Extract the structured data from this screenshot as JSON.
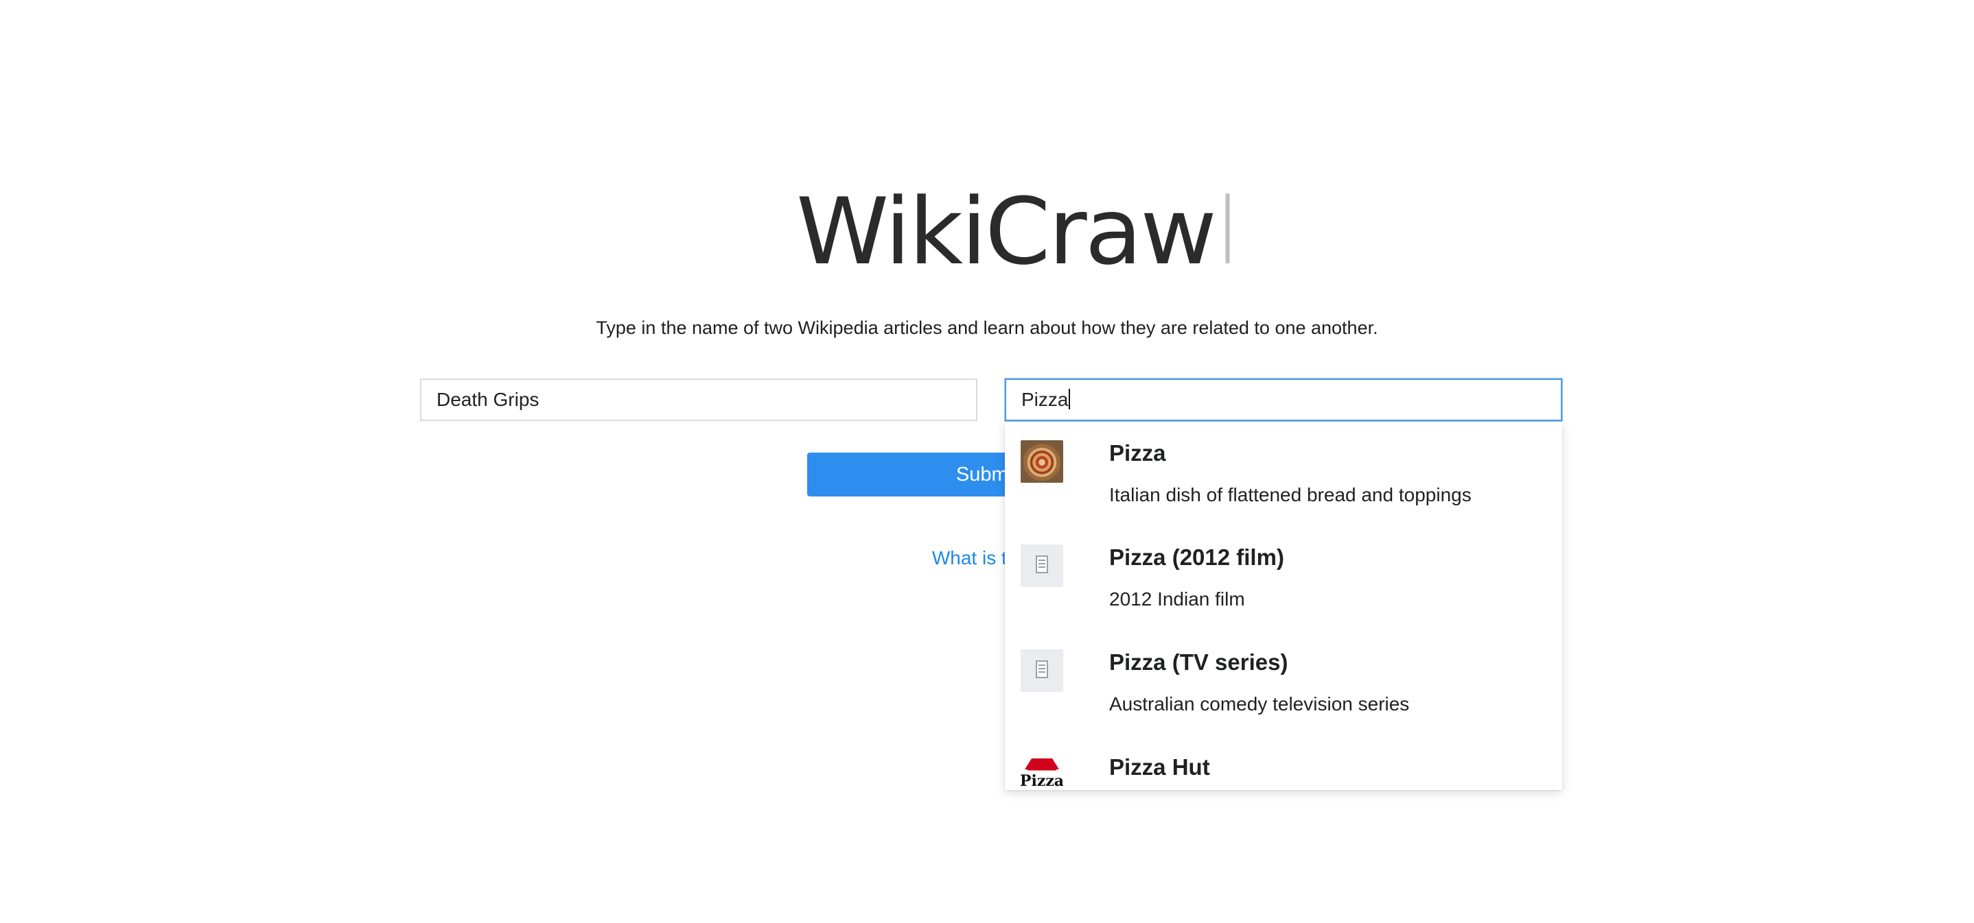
{
  "logo": {
    "main": "WikiCraw",
    "fade": "l"
  },
  "tagline": "Type in the name of two Wikipedia articles and learn about how they are related to one another.",
  "form": {
    "start_value": "Death Grips",
    "end_value": "Pizza",
    "submit_label": "Submit"
  },
  "what_link": "What is this?",
  "suggestions": [
    {
      "title": "Pizza",
      "description": "Italian dish of flattened bread and toppings",
      "thumb": "pizza-photo"
    },
    {
      "title": "Pizza (2012 film)",
      "description": "2012 Indian film",
      "thumb": "article-placeholder-icon"
    },
    {
      "title": "Pizza (TV series)",
      "description": "Australian comedy television series",
      "thumb": "article-placeholder-icon"
    },
    {
      "title": "Pizza Hut",
      "description": "",
      "thumb": "pizza-hut-logo"
    }
  ],
  "colors": {
    "accent": "#2d8ef0",
    "link": "#1e88e5",
    "focus_border": "#4a9de8"
  }
}
